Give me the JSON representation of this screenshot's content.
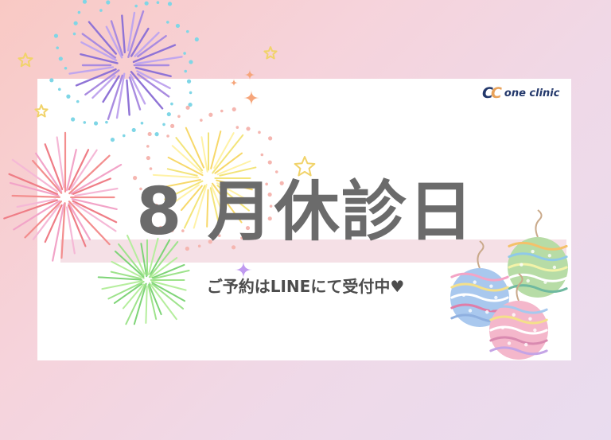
{
  "brand": {
    "logo_mark_left": "C",
    "logo_mark_right": "C",
    "name": "one clinic"
  },
  "notice": {
    "title": "8 月休診日",
    "subtitle": "ご予約はLINEにて受付中♥"
  },
  "colors": {
    "background_start": "#f9c9c4",
    "background_end": "#e9dcef",
    "card": "#ffffff",
    "title_text": "#6b6b6b",
    "brand_navy": "#23386b",
    "brand_orange": "#e8a25a"
  },
  "decorations": {
    "fireworks": [
      "purple-firework",
      "pink-red-firework",
      "yellow-firework",
      "green-firework"
    ],
    "ornaments": [
      "green-yoyo-balloon",
      "blue-yoyo-balloon",
      "pink-yoyo-balloon"
    ],
    "sparkles": [
      "star-sparkle",
      "plus-sparkle"
    ]
  }
}
